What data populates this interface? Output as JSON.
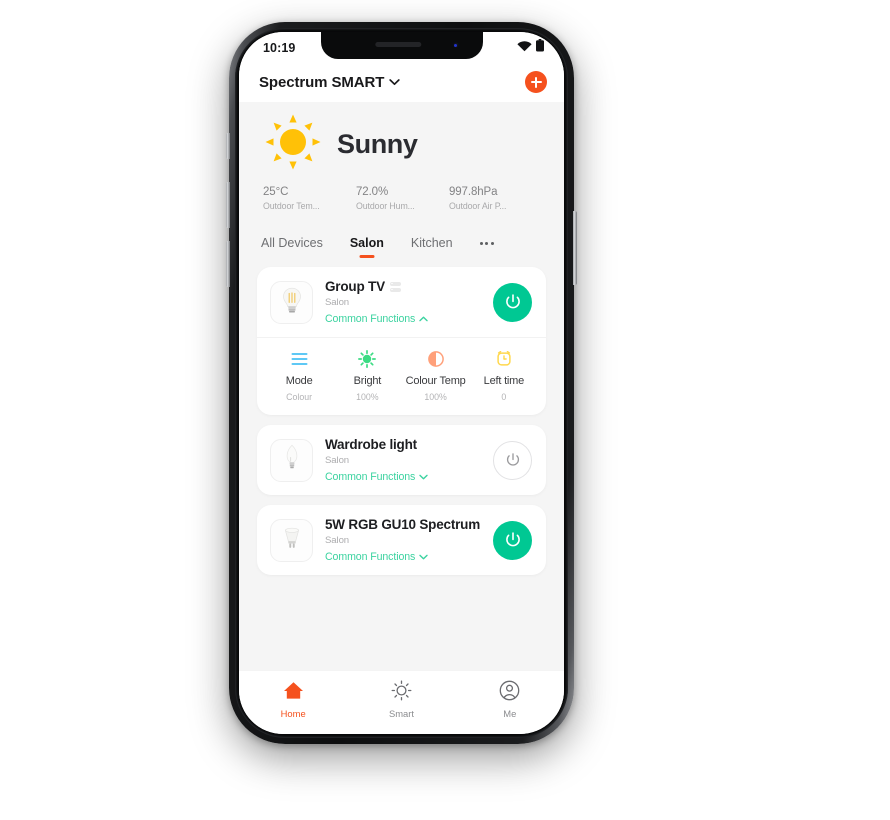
{
  "status_bar": {
    "time": "10:19",
    "wifi_icon": "wifi-icon",
    "battery_icon": "battery-icon"
  },
  "app_bar": {
    "title": "Spectrum SMART",
    "dropdown_icon": "chevron-down-icon",
    "add_label": "+",
    "add_icon": "plus-icon",
    "accent_orange": "#f5511e"
  },
  "weather": {
    "icon": "sun-icon",
    "condition": "Sunny",
    "stats": [
      {
        "value": "25°C",
        "caption": "Outdoor Tem..."
      },
      {
        "value": "72.0%",
        "caption": "Outdoor Hum..."
      },
      {
        "value": "997.8hPa",
        "caption": "Outdoor Air P..."
      }
    ]
  },
  "tabs": {
    "items": [
      {
        "label": "All Devices",
        "active": false
      },
      {
        "label": "Salon",
        "active": true
      },
      {
        "label": "Kitchen",
        "active": false
      }
    ],
    "more_icon": "more-horizontal-icon",
    "indicator_color": "#f5511e"
  },
  "devices": [
    {
      "name": "Group TV",
      "room": "Salon",
      "functions_label": "Common Functions",
      "functions_chevron": "chevron-up-icon",
      "expanded": true,
      "is_group": true,
      "power_state": "on",
      "power_icon": "power-icon",
      "thumb_icon": "filament-bulb-icon",
      "functions": [
        {
          "label": "Mode",
          "value": "Colour",
          "icon": "mode-lines-icon",
          "color": "#5ec8f5"
        },
        {
          "label": "Bright",
          "value": "100%",
          "icon": "brightness-sun-icon",
          "color": "#3ddc84"
        },
        {
          "label": "Colour Temp",
          "value": "100%",
          "icon": "half-circle-icon",
          "color": "#ffa07a"
        },
        {
          "label": "Left time",
          "value": "0",
          "icon": "alarm-clock-icon",
          "color": "#ffd84d"
        }
      ]
    },
    {
      "name": "Wardrobe light",
      "room": "Salon",
      "functions_label": "Common Functions",
      "functions_chevron": "chevron-down-icon",
      "expanded": false,
      "is_group": false,
      "power_state": "off",
      "power_icon": "power-icon",
      "thumb_icon": "candle-bulb-icon"
    },
    {
      "name": "5W RGB GU10 Spectrum",
      "room": "Salon",
      "functions_label": "Common Functions",
      "functions_chevron": "chevron-down-icon",
      "expanded": false,
      "is_group": false,
      "power_state": "on",
      "power_icon": "power-icon",
      "thumb_icon": "gu10-spotlight-icon"
    }
  ],
  "bottom_nav": {
    "items": [
      {
        "label": "Home",
        "icon": "home-icon",
        "active": true
      },
      {
        "label": "Smart",
        "icon": "sun-outline-icon",
        "active": false
      },
      {
        "label": "Me",
        "icon": "user-circle-icon",
        "active": false
      }
    ],
    "active_color": "#f5511e"
  },
  "theme": {
    "power_on_green": "#00c893",
    "link_green": "#3cd3a0",
    "page_background": "#f5f5f5"
  }
}
